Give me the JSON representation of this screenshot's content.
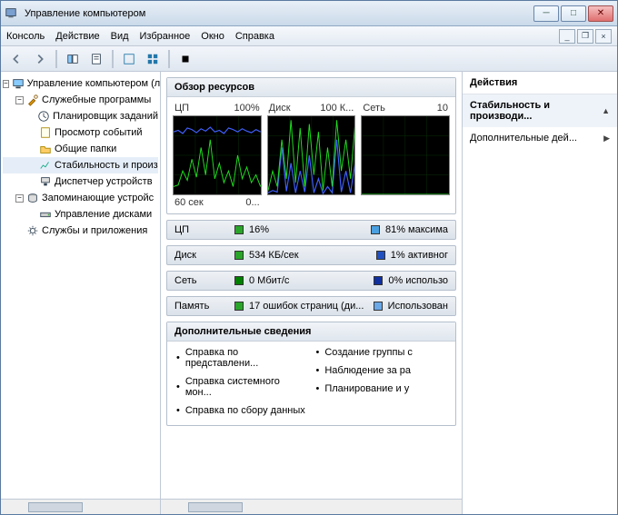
{
  "title": "Управление компьютером",
  "menu": [
    "Консоль",
    "Действие",
    "Вид",
    "Избранное",
    "Окно",
    "Справка"
  ],
  "tree": {
    "root": "Управление компьютером (л",
    "g1": "Служебные программы",
    "g1_items": [
      "Планировщик заданий",
      "Просмотр событий",
      "Общие папки",
      "Стабильность и произ",
      "Диспетчер устройств"
    ],
    "g2": "Запоминающие устройс",
    "g2_items": [
      "Управление дисками"
    ],
    "g3": "Службы и приложения"
  },
  "overview_title": "Обзор ресурсов",
  "charts": [
    {
      "left": "ЦП",
      "right": "100%",
      "bl": "60 сек",
      "br": "0..."
    },
    {
      "left": "Диск",
      "right": "100 К...",
      "bl": "",
      "br": ""
    },
    {
      "left": "Сеть",
      "right": "10",
      "bl": "",
      "br": ""
    }
  ],
  "rows": [
    {
      "name": "ЦП",
      "c1": "#2aa52a",
      "v1": "16%",
      "c2": "#4aa0e0",
      "v2": "81% максима"
    },
    {
      "name": "Диск",
      "c1": "#2aa52a",
      "v1": "534 КБ/сек",
      "c2": "#2050c0",
      "v2": "1% активног"
    },
    {
      "name": "Сеть",
      "c1": "#008000",
      "v1": "0 Мбит/с",
      "c2": "#1030a0",
      "v2": "0% использо"
    },
    {
      "name": "Память",
      "c1": "#2aa52a",
      "v1": "17 ошибок страниц (ди...",
      "c2": "#6aa8e8",
      "v2": "Использован"
    }
  ],
  "addinfo": {
    "title": "Дополнительные сведения",
    "left": [
      "Справка по представлени...",
      "Справка системного мон...",
      "Справка по сбору данных"
    ],
    "right": [
      "Создание группы с",
      "Наблюдение за ра",
      "Планирование и у"
    ]
  },
  "actions": {
    "title": "Действия",
    "group": "Стабильность и производи...",
    "more": "Дополнительные дей..."
  },
  "chart_data": [
    {
      "type": "line",
      "title": "ЦП",
      "ylim": [
        0,
        100
      ],
      "xlabel": "60 сек → 0",
      "series": [
        {
          "name": "usage",
          "color": "#20e020",
          "values": [
            10,
            12,
            30,
            18,
            45,
            22,
            60,
            25,
            70,
            20,
            40,
            15,
            30,
            10,
            50,
            20,
            35,
            15,
            25,
            10
          ]
        },
        {
          "name": "max",
          "color": "#4060ff",
          "values": [
            80,
            82,
            78,
            85,
            83,
            79,
            84,
            81,
            86,
            80,
            82,
            78,
            85,
            83,
            80,
            84,
            81,
            79,
            83,
            80
          ]
        }
      ]
    },
    {
      "type": "line",
      "title": "Диск",
      "ylim": [
        0,
        100
      ],
      "series": [
        {
          "name": "io",
          "color": "#20e020",
          "values": [
            5,
            30,
            10,
            70,
            20,
            95,
            15,
            85,
            10,
            90,
            25,
            80,
            5,
            60,
            10,
            95,
            30,
            70,
            20,
            90
          ]
        },
        {
          "name": "active",
          "color": "#4060ff",
          "values": [
            2,
            5,
            3,
            60,
            4,
            40,
            2,
            30,
            3,
            50,
            2,
            20,
            1,
            10,
            2,
            70,
            3,
            30,
            2,
            40
          ]
        }
      ]
    },
    {
      "type": "line",
      "title": "Сеть",
      "ylim": [
        0,
        10
      ],
      "series": [
        {
          "name": "util",
          "color": "#20e020",
          "values": [
            0,
            0,
            0,
            0,
            0,
            0,
            0,
            0,
            0,
            0,
            0,
            0,
            0,
            0,
            0,
            0,
            0,
            0,
            0,
            0
          ]
        }
      ]
    }
  ]
}
